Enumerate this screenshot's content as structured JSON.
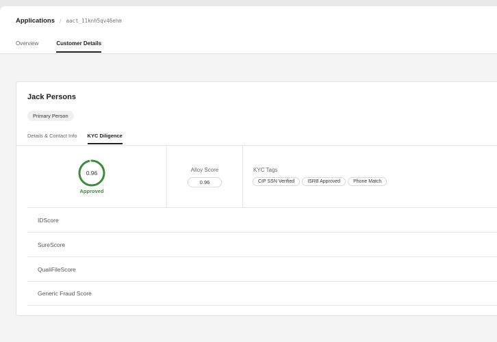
{
  "breadcrumb": {
    "root": "Applications",
    "separator": "/",
    "id": "aact_11knh5qv46ehm"
  },
  "tabs": [
    {
      "label": "Overview",
      "active": false
    },
    {
      "label": "Customer Details",
      "active": true
    }
  ],
  "person": {
    "name": "Jack Persons",
    "role": "Primary Person",
    "subtabs": [
      {
        "label": "Details & Contact Info",
        "active": false
      },
      {
        "label": "KYC Diligence",
        "active": true
      }
    ]
  },
  "summary": {
    "score": {
      "value": "0.96",
      "fraction": 0.96,
      "status": "Approved",
      "color": "#3d8b3d"
    },
    "alloy": {
      "label": "Alloy Score",
      "value": "0.96"
    },
    "kyc": {
      "label": "KYC Tags",
      "tags": [
        "CIP SSN Verified",
        "ISRB Approved",
        "Phone Match"
      ]
    }
  },
  "scores": [
    "IDScore",
    "SureScore",
    "QualiFileScore",
    "Generic Fraud Score"
  ],
  "icons": {
    "score_ring": "progress-ring"
  }
}
